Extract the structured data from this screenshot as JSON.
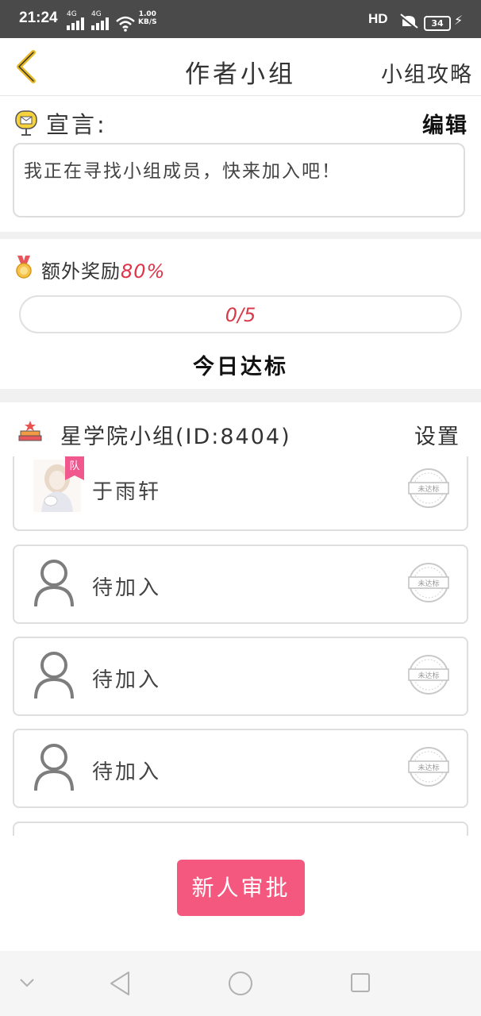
{
  "status_bar": {
    "time": "21:24",
    "signal_1": "4G",
    "signal_2": "4G",
    "speed_value": "1.00",
    "speed_unit": "KB/S",
    "hd": "HD",
    "battery": "34"
  },
  "nav": {
    "title": "作者小组",
    "right_link": "小组攻略"
  },
  "manifesto": {
    "label": "宣言:",
    "edit_label": "编辑",
    "text": "我正在寻找小组成员，快来加入吧！"
  },
  "reward": {
    "label": "额外奖励",
    "percent": "80%",
    "progress_text": "0/5",
    "progress_fraction": 0,
    "today_label": "今日达标"
  },
  "group": {
    "title": "星学院小组(ID:8404)",
    "settings_label": "设置"
  },
  "members": [
    {
      "name": "于雨轩",
      "is_leader": true,
      "badge": "队",
      "stamp": "未达标"
    },
    {
      "name": "待加入",
      "is_leader": false,
      "stamp": "未达标"
    },
    {
      "name": "待加入",
      "is_leader": false,
      "stamp": "未达标"
    },
    {
      "name": "待加入",
      "is_leader": false,
      "stamp": "未达标"
    }
  ],
  "approve_button": "新人审批",
  "colors": {
    "accent_pink": "#f5587f",
    "progress_text": "#d93a4a",
    "back_arrow": "#e8b923"
  }
}
